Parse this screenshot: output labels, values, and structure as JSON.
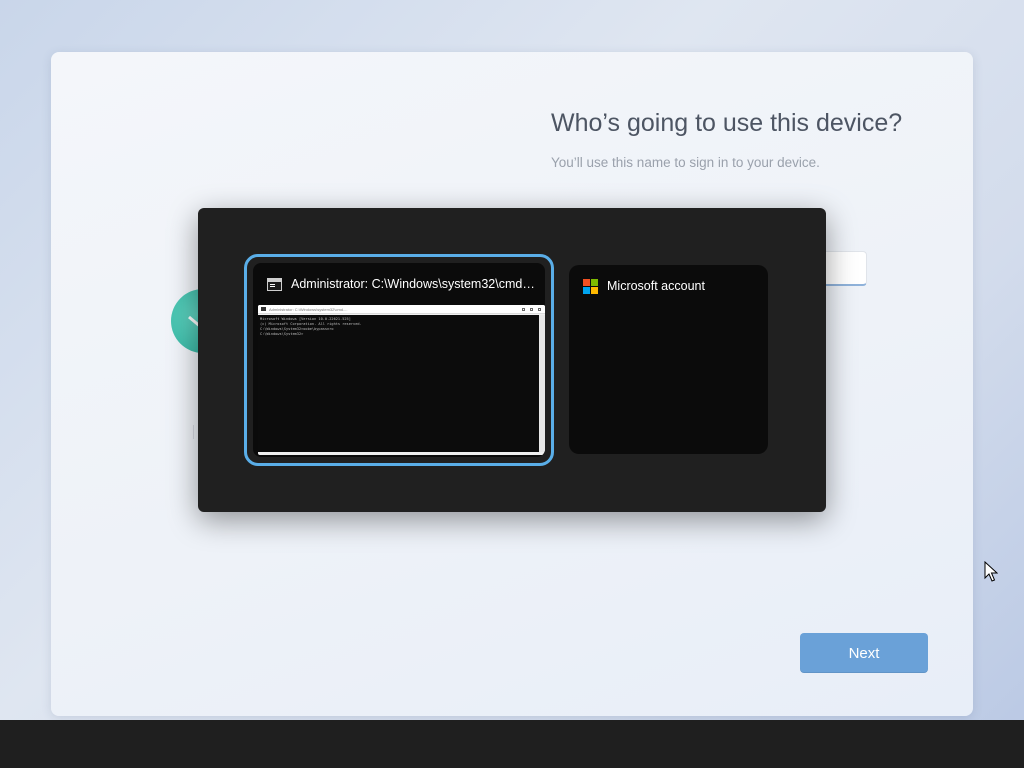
{
  "oobe": {
    "heading": "Who’s going to use this device?",
    "subtitle": "You’ll use this name to sign in to your device.",
    "name_input_value": "",
    "next_label": "Next"
  },
  "task_switcher": {
    "windows": [
      {
        "title": "Administrator: C:\\Windows\\system32\\cmd....",
        "icon": "cmd-icon",
        "selected": true,
        "console_lines": [
          "Microsoft Windows [Version 10.0.22621.525]",
          "(c) Microsoft Corporation. All rights reserved.",
          "",
          "C:\\Windows\\System32>oobe\\bypassnro",
          "",
          "C:\\Windows\\System32>"
        ]
      },
      {
        "title": "Microsoft account",
        "icon": "microsoft-logo-icon",
        "selected": false
      }
    ]
  },
  "colors": {
    "accent": "#5aaee8",
    "next_button": "#6aa1d8",
    "switcher_bg": "#202020",
    "ms_logo": [
      "#f25022",
      "#7fba00",
      "#00a4ef",
      "#ffb900"
    ]
  }
}
